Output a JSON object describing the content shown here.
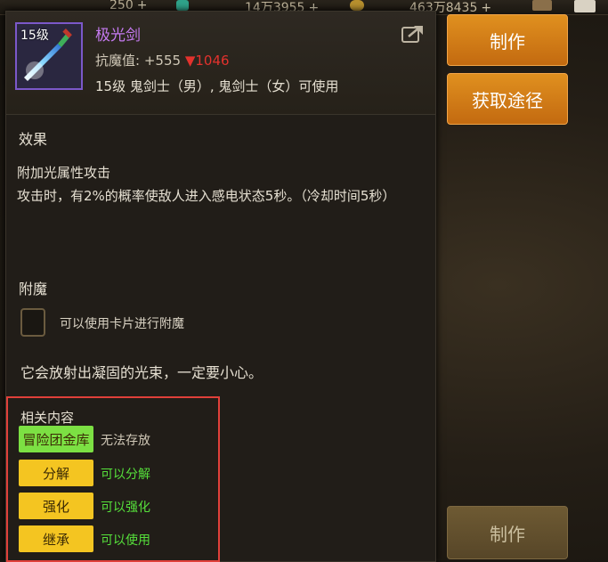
{
  "topbar": {
    "stat1": "250",
    "stat2": "14万3955",
    "stat3": "463万8435",
    "plus": "+"
  },
  "side": {
    "craft_label": "制作",
    "source_label": "获取途径",
    "craft_bottom_label": "制作"
  },
  "item": {
    "level": "15级",
    "name": "极光剑",
    "stat_label": "抗魔值:",
    "stat_value": "+555",
    "stat_diff": "▼1046",
    "requirement": "15级 鬼剑士（男）, 鬼剑士（女）可使用"
  },
  "effect": {
    "title": "效果",
    "line1": "附加光属性攻击",
    "line2": "攻击时，有2%的概率使敌人进入感电状态5秒。（冷却时间5秒）"
  },
  "enchant": {
    "title": "附魔",
    "hint": "可以使用卡片进行附魔"
  },
  "flavor": "它会放射出凝固的光束，一定要小心。",
  "related": {
    "title": "相关内容",
    "rows": [
      {
        "label": "冒险团金库",
        "status": "无法存放"
      },
      {
        "label": "分解",
        "status": "可以分解"
      },
      {
        "label": "强化",
        "status": "可以强化"
      },
      {
        "label": "继承",
        "status": "可以使用"
      }
    ]
  },
  "colors": {
    "item_name": "#c57af0",
    "stat_down": "#e3322d",
    "highlight_frame": "#e0403a",
    "status_ok": "#56e03b",
    "btn_green": "#7ce043",
    "btn_yellow": "#f4c521"
  }
}
